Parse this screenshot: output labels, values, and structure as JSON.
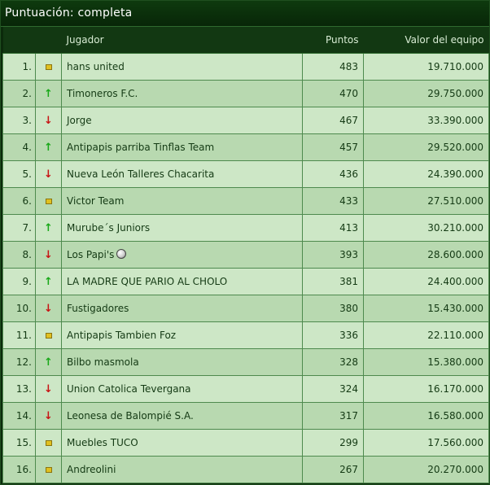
{
  "title": "Puntuación: completa",
  "columns": {
    "rank": "",
    "trend": "",
    "player": "Jugador",
    "points": "Puntos",
    "value": "Valor del equipo"
  },
  "rows": [
    {
      "rank": "1.",
      "trend": "same",
      "player": "hans united",
      "points": "483",
      "value": "19.710.000"
    },
    {
      "rank": "2.",
      "trend": "up",
      "player": "Timoneros F.C.",
      "points": "470",
      "value": "29.750.000"
    },
    {
      "rank": "3.",
      "trend": "down",
      "player": "Jorge",
      "points": "467",
      "value": "33.390.000"
    },
    {
      "rank": "4.",
      "trend": "up",
      "player": "Antipapis parriba Tinflas Team",
      "points": "457",
      "value": "29.520.000"
    },
    {
      "rank": "5.",
      "trend": "down",
      "player": "Nueva León Talleres Chacarita",
      "points": "436",
      "value": "24.390.000"
    },
    {
      "rank": "6.",
      "trend": "same",
      "player": "Victor Team",
      "points": "433",
      "value": "27.510.000"
    },
    {
      "rank": "7.",
      "trend": "up",
      "player": "Murube´s Juniors",
      "points": "413",
      "value": "30.210.000"
    },
    {
      "rank": "8.",
      "trend": "down",
      "player": "Los Papi's",
      "points": "393",
      "value": "28.600.000",
      "badge": "ball-icon"
    },
    {
      "rank": "9.",
      "trend": "up",
      "player": "LA MADRE QUE PARIO AL CHOLO",
      "points": "381",
      "value": "24.400.000"
    },
    {
      "rank": "10.",
      "trend": "down",
      "player": "Fustigadores",
      "points": "380",
      "value": "15.430.000"
    },
    {
      "rank": "11.",
      "trend": "same",
      "player": "Antipapis Tambien Foz",
      "points": "336",
      "value": "22.110.000"
    },
    {
      "rank": "12.",
      "trend": "up",
      "player": "Bilbo masmola",
      "points": "328",
      "value": "15.380.000"
    },
    {
      "rank": "13.",
      "trend": "down",
      "player": "Union Catolica Tevergana",
      "points": "324",
      "value": "16.170.000"
    },
    {
      "rank": "14.",
      "trend": "down",
      "player": "Leonesa de Balompié S.A.",
      "points": "317",
      "value": "16.580.000"
    },
    {
      "rank": "15.",
      "trend": "same",
      "player": "Muebles TUCO",
      "points": "299",
      "value": "17.560.000"
    },
    {
      "rank": "16.",
      "trend": "same",
      "player": "Andreolini",
      "points": "267",
      "value": "20.270.000"
    }
  ],
  "colors": {
    "background": "#0b2a0b",
    "row_odd": "#cde7c6",
    "row_even": "#b8d9b0",
    "trend_up": "#18a818",
    "trend_down": "#c81414",
    "trend_same": "#e0c020"
  },
  "icons": {
    "up": "up-arrow-icon",
    "down": "down-arrow-icon",
    "same": "unchanged-square-icon"
  }
}
